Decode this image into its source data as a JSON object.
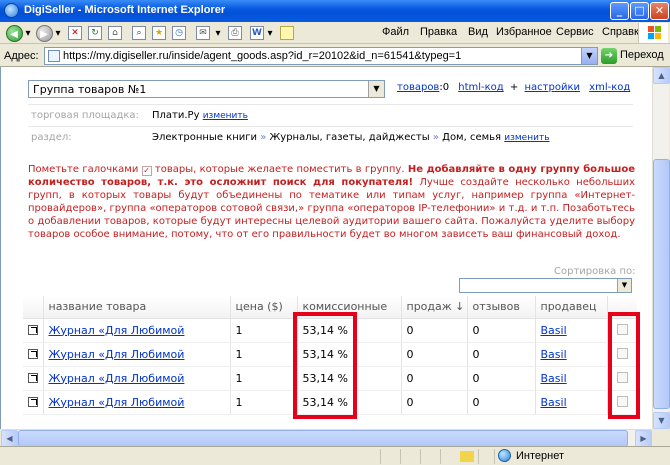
{
  "window": {
    "title": "DigiSeller - Microsoft Internet Explorer",
    "controls": {
      "minimize": "_",
      "maximize": "□",
      "close": "✕"
    }
  },
  "menu": [
    "Файл",
    "Правка",
    "Вид",
    "Избранное",
    "Сервис",
    "Справка"
  ],
  "address": {
    "label": "Адрес:",
    "url": "https://my.digiseller.ru/inside/agent_goods.asp?id_r=20102&id_n=61541&typeg=1",
    "go_label": "Переход"
  },
  "page": {
    "group_select": "Группа товаров №1",
    "links": {
      "goods_label": "товаров",
      "goods_count": ":0",
      "html_code": "html-код",
      "plus": "+",
      "settings": "настройки",
      "xml_code": "xml-код"
    },
    "platform_label": "торговая площадка:",
    "platform_value": "Плати.Ру",
    "platform_change": "изменить",
    "section_label": "раздел:",
    "section_value": [
      "Электронные книги",
      "Журналы, газеты, дайджесты",
      "Дом, семья"
    ],
    "section_arrow": "»",
    "section_change": "изменить",
    "notice": {
      "part1": "Пометьте галочками",
      "check": "✓",
      "part2": "товары, которые желаете поместить в группу.",
      "bold": "Не добавляйте в одну группу большое количество товаров, т.к. это осложнит поиск для покупателя!",
      "part3": "Лучше создайте несколько небольших групп, в которых товары будут объединены по тематике или типам услуг, например группа «Интернет-провайдеров», группа «операторов сотовой связи,» группа «операторов IP-телефонии» и т.д. и т.п. Позаботьтесь о добавлении товаров, которые будут интересны целевой аудитории вашего сайта. Пожалуйста уделите выбору товаров особое внимание, потому, что от его правильности будет во многом зависеть ваш финансовый доход."
    },
    "sort_label": "Сортировка по:",
    "table": {
      "headers": [
        "название товара",
        "цена ($)",
        "комиссионные",
        "продаж ↓",
        "отзывов",
        "продавец"
      ],
      "rows": [
        {
          "name": "Журнал «Для Любимой",
          "price": "1",
          "commission": "53,14 %",
          "sales": "0",
          "reviews": "0",
          "seller": "Basil"
        },
        {
          "name": "Журнал «Для Любимой",
          "price": "1",
          "commission": "53,14 %",
          "sales": "0",
          "reviews": "0",
          "seller": "Basil"
        },
        {
          "name": "Журнал «Для Любимой",
          "price": "1",
          "commission": "53,14 %",
          "sales": "0",
          "reviews": "0",
          "seller": "Basil"
        },
        {
          "name": "Журнал «Для Любимой",
          "price": "1",
          "commission": "53,14 %",
          "sales": "0",
          "reviews": "0",
          "seller": "Basil"
        }
      ]
    }
  },
  "status": {
    "zone": "Интернет"
  },
  "colors": {
    "highlight": "#e6001a",
    "notice": "#c41f1f",
    "link": "#0033cc"
  }
}
